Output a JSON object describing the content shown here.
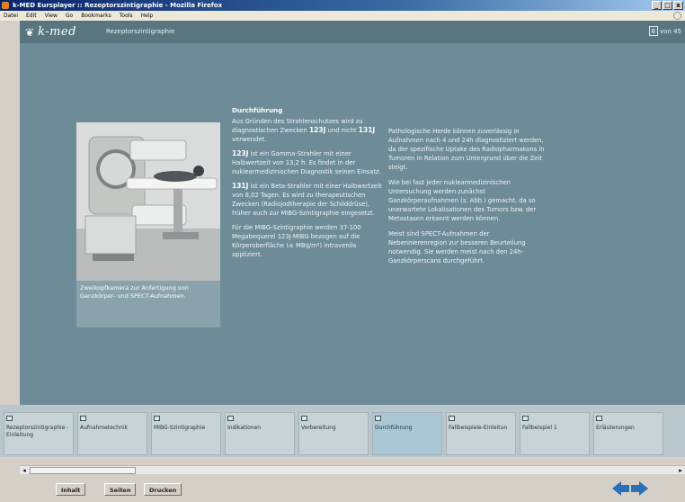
{
  "window": {
    "title": "k-MED Eursplayer :: Rezeptorszintigraphie - Mozilla Firefox",
    "buttons": {
      "minimize": "_",
      "maximize": "□",
      "close": "x"
    }
  },
  "menu": [
    "Datei",
    "Edit",
    "View",
    "Go",
    "Bookmarks",
    "Tools",
    "Help"
  ],
  "header": {
    "logo": "k-med",
    "title": "Rezeptorszintigraphie",
    "page_current": "6",
    "page_suffix": "von 45"
  },
  "photo": {
    "caption": "Zweikopfkamera zur Anfertigung von Ganzkörper- und SPECT-Aufnahmen."
  },
  "col1": {
    "heading": "Durchführung",
    "p1_a": "Aus Gründen des Strahlenschutzes wird zu diagnostischen Zwecken",
    "p1_iso1": "123J",
    "p1_b": "und nicht",
    "p1_iso2": "131J",
    "p1_c": "verwendet.",
    "p2_iso": "123J",
    "p2": "ist ein Gamma-Strahler mit einer Halbwertzeit von 13,2 h. Es findet in der nuklearmedizinischen Diagnostik seinen Einsatz.",
    "p3_iso": "131J",
    "p3": "ist ein Beta-Strahler mit einer Halbwertzeit von 8,02 Tagen. Es wird zu therapeutischen Zwecken (Radiojodtherapie der Schilddrüse), früher auch zur MIBG-Szintigraphie eingesetzt.",
    "p4": "Für die MIBG-Szintigraphie werden 37-100 Megabequerel 123J-MIBG bezogen auf die Körperoberfläche (≤ MBq/m²) intravenös appliziert."
  },
  "col2": {
    "p1": "Pathologische Herde können zuverlässig in Aufnahmen nach 4 und 24h diagnostiziert werden, da der spezifische Uptake des Radiopharmakons in Tumoren in Relation zum Untergrund über die Zeit steigt.",
    "p2": "Wie bei fast jeder nuklearmedizinischen Untersuchung werden zunächst Ganzkörperaufnahmen (s. Abb.) gemacht, da so unerwartete Lokalisationen des Tumors bzw. der Metastasen erkannt werden können.",
    "p3": "Meist sind SPECT-Aufnahmen der Nebennierenregion zur besseren Beurteilung notwendig. Sie werden meist nach den 24h-Ganzkörperscans durchgeführt."
  },
  "nav": [
    {
      "label": "Rezeptorszintigraphie - Einleitung"
    },
    {
      "label": "Aufnahmetechnik"
    },
    {
      "label": "MIBG-Szintigraphie"
    },
    {
      "label": "Indikationen"
    },
    {
      "label": "Vorbereitung"
    },
    {
      "label": "Durchführung"
    },
    {
      "label": "Fallbeispiele-Einleitun"
    },
    {
      "label": "Fallbeispiel 1"
    },
    {
      "label": "Erläuterungen"
    }
  ],
  "footer": {
    "inhalt": "Inhalt",
    "seiten": "Seiten",
    "drucken": "Drucken"
  },
  "colors": {
    "content_bg": "#6e8c98",
    "header_bg": "#597680",
    "nav_active": "#a9c8d3",
    "arrow_blue": "#2a6fb8"
  }
}
